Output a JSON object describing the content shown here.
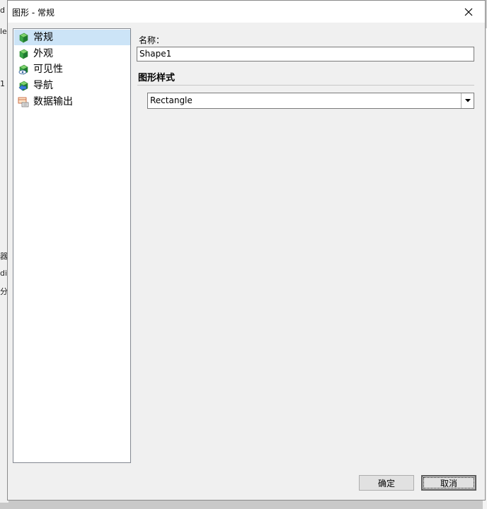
{
  "background": {
    "fragments": [
      "d",
      "le",
      "1",
      "器",
      "di",
      "分"
    ]
  },
  "dialog": {
    "title": "图形 - 常规",
    "close_icon": "close-icon"
  },
  "nav": {
    "items": [
      {
        "label": "常规",
        "icon": "cube-green-icon",
        "selected": true
      },
      {
        "label": "外观",
        "icon": "cube-green-icon",
        "selected": false
      },
      {
        "label": "可见性",
        "icon": "eye-cube-icon",
        "selected": false
      },
      {
        "label": "导航",
        "icon": "navigation-cube-icon",
        "selected": false
      },
      {
        "label": "数据输出",
        "icon": "data-output-icon",
        "selected": false
      }
    ]
  },
  "form": {
    "name_label": "名称：",
    "name_value": "Shape1",
    "section_title": "图形样式",
    "shape_style_value": "Rectangle"
  },
  "buttons": {
    "ok": "确定",
    "cancel": "取消"
  },
  "colors": {
    "selected_row": "#cce4f7",
    "dialog_bg": "#f0f0f0"
  }
}
